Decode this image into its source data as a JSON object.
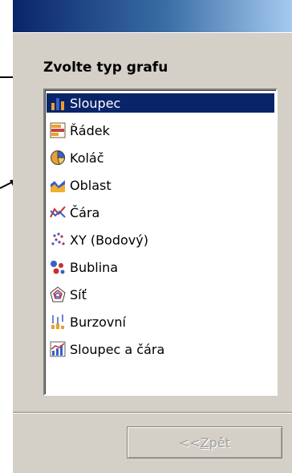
{
  "dialog": {
    "heading": "Zvolte typ grafu",
    "back_button": {
      "prefix": "<< ",
      "accel": "Z",
      "rest": "pět"
    }
  },
  "chart_types": [
    {
      "label": "Sloupec",
      "icon": "column-chart-icon",
      "selected": true
    },
    {
      "label": "Řádek",
      "icon": "bar-chart-icon",
      "selected": false
    },
    {
      "label": "Koláč",
      "icon": "pie-chart-icon",
      "selected": false
    },
    {
      "label": "Oblast",
      "icon": "area-chart-icon",
      "selected": false
    },
    {
      "label": "Čára",
      "icon": "line-chart-icon",
      "selected": false
    },
    {
      "label": "XY (Bodový)",
      "icon": "scatter-chart-icon",
      "selected": false
    },
    {
      "label": "Bublina",
      "icon": "bubble-chart-icon",
      "selected": false
    },
    {
      "label": "Síť",
      "icon": "radar-chart-icon",
      "selected": false
    },
    {
      "label": "Burzovní",
      "icon": "stock-chart-icon",
      "selected": false
    },
    {
      "label": "Sloupec a čára",
      "icon": "column-line-chart-icon",
      "selected": false
    }
  ],
  "colors": {
    "selection": "#0a246a",
    "dialog_bg": "#d4d0c8",
    "title_start": "#0a246a",
    "title_end": "#a6caf0"
  }
}
